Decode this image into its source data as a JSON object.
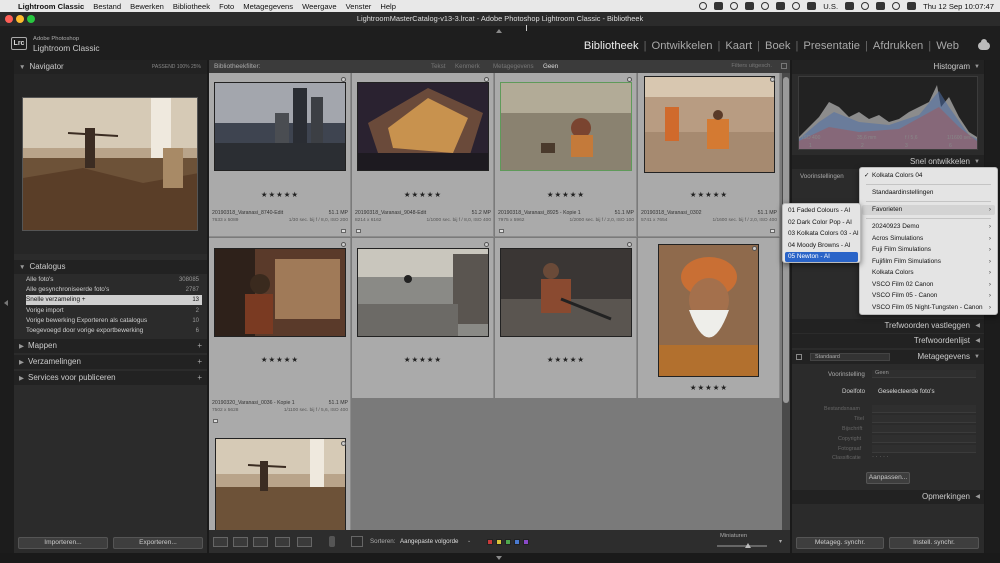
{
  "menubar": {
    "app": "Lightroom Classic",
    "items": [
      "Bestand",
      "Bewerken",
      "Bibliotheek",
      "Foto",
      "Metagegevens",
      "Weergave",
      "Venster",
      "Help"
    ],
    "input_lang": "U.S.",
    "clock": "Thu 12 Sep  10:07:47"
  },
  "window": {
    "title": "LightroomMasterCatalog-v13-3.lrcat - Adobe Photoshop Lightroom Classic - Bibliotheek"
  },
  "identity": {
    "logo": "Lrc",
    "line1": "Adobe Photoshop",
    "line2": "Lightroom Classic"
  },
  "modules": [
    "Bibliotheek",
    "Ontwikkelen",
    "Kaart",
    "Boek",
    "Presentatie",
    "Afdrukken",
    "Web"
  ],
  "left": {
    "navigator": {
      "title": "Navigator",
      "opts": "PASSEND   100%   25%"
    },
    "catalog": {
      "title": "Catalogus",
      "rows": [
        {
          "label": "Alle foto's",
          "count": "308085"
        },
        {
          "label": "Alle gesynchroniseerde foto's",
          "count": "2787"
        },
        {
          "label": "Snelle verzameling  +",
          "count": "13"
        },
        {
          "label": "Vorige import",
          "count": "2"
        },
        {
          "label": "Vorige bewerking Exporteren als catalogus",
          "count": "10"
        },
        {
          "label": "Toegevoegd door vorige exportbewerking",
          "count": "6"
        }
      ]
    },
    "folders": "Mappen",
    "collections": "Verzamelingen",
    "services": "Services voor publiceren",
    "import_btn": "Importeren...",
    "export_btn": "Exporteren..."
  },
  "filter": {
    "title": "Bibliotheekfilter:",
    "tabs": [
      "Tekst",
      "Kenmerk",
      "Metagegevens",
      "Geen"
    ],
    "filters_off": "Filters uitgesch."
  },
  "photos": [
    {
      "name": "20190318_Varanasi_8740-Edit",
      "mp": "51.1 MP",
      "dims": "7633 x 5089",
      "exif": "1/30 sec. bij f / 8,0, ISO 200",
      "stars": "★★★★★"
    },
    {
      "name": "20190318_Varanasi_9048-Edit",
      "mp": "51.2 MP",
      "dims": "8214 x 6162",
      "exif": "1/1000 sec. bij f / 8,0, ISO 400",
      "stars": "★★★★★"
    },
    {
      "name": "20190318_Varanasi_8925 - Kopie 1",
      "mp": "51.1 MP",
      "dims": "7975 x 5962",
      "exif": "1/2000 sec. bij f / 2,0, ISO 100",
      "stars": "★★★★★"
    },
    {
      "name": "20190318_Varanasi_0302",
      "mp": "51.1 MP",
      "dims": "5741 x 7654",
      "exif": "1/1600 sec. bij f / 2,0, ISO 400",
      "stars": "★★★★★"
    },
    {
      "name": "",
      "mp": "",
      "dims": "",
      "exif": "",
      "stars": "★★★★★"
    },
    {
      "name": "",
      "mp": "",
      "dims": "",
      "exif": "",
      "stars": "★★★★★"
    },
    {
      "name": "",
      "mp": "",
      "dims": "",
      "exif": "",
      "stars": "★★★★★"
    },
    {
      "name": "",
      "mp": "",
      "dims": "",
      "exif": "",
      "stars": "★★★★★"
    },
    {
      "name": "20190320_Varanasi_0036 - Kopie 1",
      "mp": "51.1 MP",
      "dims": "7502 x 5628",
      "exif": "1/1100 sec. bij f / 5,6, ISO 400",
      "stars": ""
    }
  ],
  "bottombar": {
    "sort_label": "Sorteren:",
    "sort_value": "Aangepaste volgorde",
    "thumb_label": "Miniaturen"
  },
  "right": {
    "histogram": {
      "title": "Histogram",
      "iso": "ISO 400",
      "focal": "35,6 mm",
      "aperture": "f / 5,6",
      "shutter": "1/1600 sec.",
      "c1": "1",
      "c2": "2",
      "c3": "3",
      "c4": "6"
    },
    "quick": {
      "title": "Snel ontwikkelen",
      "preset_label": "Voorinstellingen"
    },
    "keywording": "Trefwoorden vastleggen",
    "keywordlist": "Trefwoordenlijst",
    "metadata": {
      "title": "Metagegevens",
      "preset_sel": "Standaard",
      "voorinstelling": "Voorinstelling",
      "voorinstelling_val": "Geen",
      "doelfoto": "Doelfoto",
      "doelfoto_val": "Geselecteerde foto's",
      "fields": [
        "Bestandsnaam",
        "Titel",
        "Bijschrift",
        "Copyright",
        "Fotograaf",
        "Classificatie"
      ],
      "rating_dots": "·  ·  ·  ·  ·",
      "apply_btn": "Aanpassen..."
    },
    "comments": "Opmerkingen",
    "sync_meta": "Metageg. synchr.",
    "sync_settings": "Instell. synchr."
  },
  "menu_main": {
    "items": [
      {
        "label": "Kolkata Colors 04",
        "checked": "✓"
      },
      {
        "label": "Standaardinstellingen"
      },
      {
        "label": "Favorieten",
        "sub": "›"
      },
      {
        "label": "20240923 Demo",
        "sub": "›"
      },
      {
        "label": "Acros Simulations",
        "sub": "›"
      },
      {
        "label": "Fuji Film Simulations",
        "sub": "›"
      },
      {
        "label": "Fujifilm Film Simulations",
        "sub": "›"
      },
      {
        "label": "Kolkata Colors",
        "sub": "›"
      },
      {
        "label": "VSCO Film 02 Canon",
        "sub": "›"
      },
      {
        "label": "VSCO Film 05 - Canon",
        "sub": "›"
      },
      {
        "label": "VSCO Film 05 Night-Tungsten - Canon",
        "sub": "›"
      }
    ]
  },
  "menu_sub": {
    "items": [
      "01 Faded Colours - AI",
      "02 Dark Color Pop - AI",
      "03 Kolkata Colors 03 - AI",
      "04 Moody Browns - AI",
      "05 Newton - AI"
    ]
  },
  "colors": {
    "accent": "#2a64c8",
    "panel": "#2b2b2b",
    "grid_bg": "#868686"
  }
}
